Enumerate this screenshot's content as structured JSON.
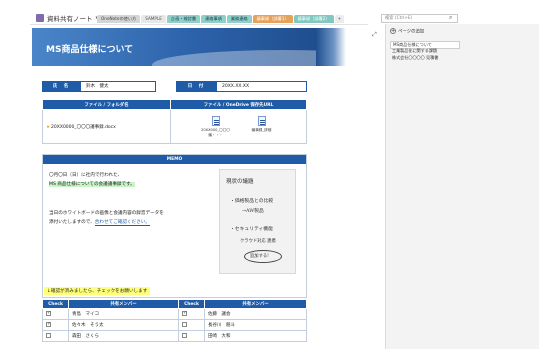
{
  "notebook": {
    "title": "資料共有ノート",
    "caret": "▾"
  },
  "tabs": [
    {
      "label": "OneNoteの使い方",
      "cls": "t1"
    },
    {
      "label": "SAMPLE",
      "cls": "t2"
    },
    {
      "label": "企画・検討書",
      "cls": "t3"
    },
    {
      "label": "連絡事項",
      "cls": "t4"
    },
    {
      "label": "業務連絡",
      "cls": "t5"
    },
    {
      "label": "議事録（部署1）",
      "cls": "t6"
    },
    {
      "label": "議事録（部署2）",
      "cls": "t7"
    }
  ],
  "tab_add_label": "+",
  "search": {
    "placeholder": "検索 (Ctrl+E)",
    "icon": "search-icon"
  },
  "page": {
    "title": "MS商品仕様について",
    "name_label": "氏　名",
    "name_value": "鈴木　健太",
    "date_label": "日　付",
    "date_value": "20XX.XX.XX"
  },
  "files": {
    "col1": "ファイル / フォルダ名",
    "col2": "ファイル / OneDrive 保存先URL",
    "filename": "20XX0000_〇〇〇議事録.docx",
    "attachments": [
      {
        "label": "20XX000_〇〇〇議・・・",
        "icon": "word-doc-icon"
      },
      {
        "label": "議事録_詳細",
        "icon": "document-icon"
      }
    ]
  },
  "memo": {
    "header": "MEMO",
    "line1": "〇月〇日（日）に社内で行われた、",
    "line2": "MS 商品仕様についての会議議事録です。",
    "line3": "当日のホワイトボードの画像と会議内容の録音データを",
    "line4_a": "添付いたしますので、",
    "line4_b": "合わせてご確認ください。",
    "whiteboard": {
      "l1": "現状の議題",
      "l2": "・価格製品との比較",
      "l3": "→AW製品",
      "l4": "・セキュリティ機能",
      "l5": "クラウド対応 連携",
      "l6": "追加する!"
    }
  },
  "checklist": {
    "note": "↓確認が済みましたら、チェックをお願いします",
    "h_check1": "Check",
    "h_member1": "共有メンバー",
    "h_check2": "Check",
    "h_member2": "共有メンバー",
    "rows": [
      {
        "c1": true,
        "m1": "青島　マイコ",
        "c2": true,
        "m2": "佐藤　議会"
      },
      {
        "c1": true,
        "m1": "佐々木　そう太",
        "c2": false,
        "m2": "長谷川　朋斗"
      },
      {
        "c1": false,
        "m1": "森田　さくら",
        "c2": false,
        "m2": "田崎　大和"
      }
    ]
  },
  "pane": {
    "add_page_label": "ページの追加",
    "pages": [
      {
        "label": "MS商品仕様について",
        "selected": true
      },
      {
        "label": "工業製品化に関する課題",
        "selected": false
      },
      {
        "label": "株式会社〇〇〇〇 見積書",
        "selected": false
      }
    ]
  },
  "colors": {
    "accent": "#1f5ba6",
    "banner": "#2d63ab",
    "highlight": "#ffff7a"
  }
}
